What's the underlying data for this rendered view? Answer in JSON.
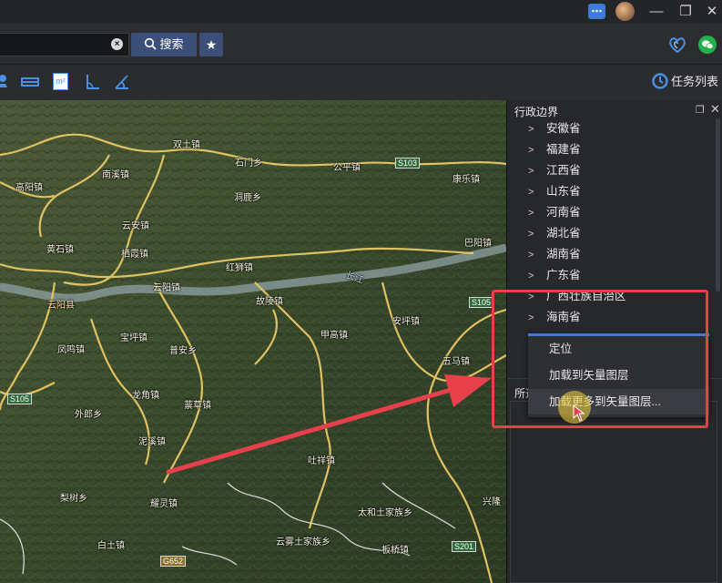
{
  "search": {
    "placeholder": "",
    "value": "",
    "button_label": "搜索"
  },
  "toolbar": {
    "task_list_label": "任务列表"
  },
  "panel": {
    "title": "行政边界",
    "provinces": [
      "安徽省",
      "福建省",
      "江西省",
      "山东省",
      "河南省",
      "湖北省",
      "湖南省",
      "广东省",
      "广西壮族自治区",
      "海南省"
    ],
    "sub_label": "所选"
  },
  "context_menu": {
    "items": [
      "定位",
      "加载到矢量图层",
      "加载更多到矢量图层..."
    ]
  },
  "map": {
    "labels": [
      "双土镇",
      "石门乡",
      "公平镇",
      "南溪镇",
      "高阳镇",
      "洞鹿乡",
      "康乐镇",
      "云安镇",
      "黄石镇",
      "栖霞镇",
      "红狮镇",
      "云阳镇",
      "云阳县",
      "故陵镇",
      "巴阳镇",
      "甲高镇",
      "安坪镇",
      "凤鸣镇",
      "宝坪镇",
      "普安乡",
      "蔈草镇",
      "五马镇",
      "外郎乡",
      "龙角镇",
      "泥溪镇",
      "吐祥镇",
      "梨树乡",
      "耀灵镇",
      "太和土家族乡",
      "兴隆",
      "白土镇",
      "云雾土家族乡",
      "板桥镇",
      "长江"
    ],
    "road_tags": [
      "S103",
      "S105",
      "S105",
      "G652",
      "S201"
    ]
  },
  "colors": {
    "accent": "#3b4f78",
    "highlight_box": "#e8404b",
    "arrow": "#e8404b",
    "selection_bar": "#3d7bd8"
  },
  "icons": [
    "chat-icon",
    "avatar",
    "minimize-icon",
    "restore-icon",
    "close-icon",
    "search-icon",
    "star-icon",
    "heart-icon",
    "wechat-icon",
    "ruler-icon",
    "area-icon",
    "angle-icon",
    "compass-icon",
    "task-icon",
    "float-icon",
    "close-panel-icon"
  ]
}
